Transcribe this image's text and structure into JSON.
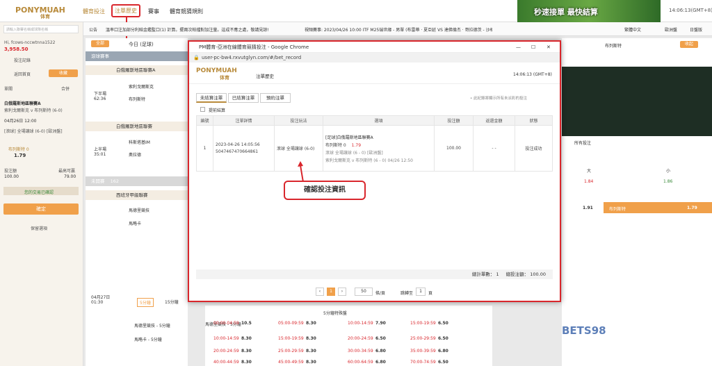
{
  "app": {
    "logo": "PONYMUAH",
    "logo_sub": "体育",
    "nav": [
      "體育投注",
      "注單歷史",
      "賽事",
      "體育競猜規則"
    ],
    "banner_text": "秒速接單 最快結算",
    "clock": "14:06:13(GMT+8)"
  },
  "announcement": {
    "label": "公告",
    "text": "溫率口注加部分利賠金鑑監口(1) 計算。擺兩次帕擋對加注量。這成不應之處，敬請見諒!",
    "event_text": "視頻賽事: 2023/04/26 10:00 ITF M25瑞世緣 - 男單 (布雷蒂 · 夏亞延 VS 達佛倫杰 · 哥拉德茨 - 沙格)",
    "lang": "繁體中文",
    "odds_type": "歐洲盤",
    "view": "日盤版"
  },
  "left": {
    "search_placeholder": "請輸入聯賽名稱或球隊名稱",
    "user": "Hi, fcows-nccwtnna1522",
    "balance": "3,958.50",
    "bet_records": "投注記錄",
    "back_home": "返回首頁",
    "view": "收藏",
    "single": "單關",
    "combo": "合併",
    "league": "白俄羅斯地區聯賽A",
    "match": "索利戈爾斯克 v 布列斯特 (6-0)",
    "date": "04月26日 12:00",
    "market": "[滾球] 全場讓球 (6-0) [歐洲盤]",
    "pick": "布列斯特 0",
    "odds": "1.79",
    "stake_label": "投注額",
    "max_label": "最高可贏",
    "stake": "100.00",
    "max_win": "79.00",
    "quick_bet": "您的交易已確認",
    "confirm": "確定",
    "keep": "保留選項"
  },
  "mid": {
    "filter_all": "全部",
    "today": "今日 (足球)",
    "live_label": "滾球賽事",
    "league1": "白俄羅斯地區聯賽A",
    "m1_time": "下半場\n62:36",
    "m1_home": "索利戈爾斯克",
    "m1_away": "布列斯特",
    "league2": "白俄羅斯地區聯賽",
    "m2_time": "上半場\n35:01",
    "m2_home": "科斯塔基IM",
    "m2_away": "奧拉德",
    "upcoming_label": "未開賽",
    "upcoming_count": "162",
    "league3": "西班牙甲級聯賽",
    "m3_home": "馬德里競技",
    "m3_away": "馬略卡",
    "m4_date": "04月27日\n01:30",
    "m4_tag": "5分鐘",
    "m4_tag2": "15分鐘"
  },
  "dialog": {
    "window_title": "PM體育-亞洲在線體育競猜投注 - Google Chrome",
    "url": "user-pc-bw4.rxvutglyn.com/#/bet_record",
    "logo": "PONYMUAH",
    "logo_sub": "体育",
    "section_title": "注單歷史",
    "time": "14:06:13 (GMT+8)",
    "tabs": [
      "未結算注單",
      "已結算注單",
      "預約注單"
    ],
    "note": "• 此紀錄將顯示所有未派彩的投注",
    "checkbox_label": "提前結算",
    "headers": [
      "編號",
      "注單詳情",
      "投注玩法",
      "選項",
      "投注額",
      "返還金額",
      "狀態"
    ],
    "row": {
      "no": "1",
      "datetime": "2023-04-26 14:05:56",
      "bet_id": "5047467470664861",
      "play": "滾球 全場讓球 (6-0)",
      "league": "[足球]白俄羅斯地區聯賽A",
      "pick_line": "布列斯特 0",
      "pick_odds": "1.79",
      "market": "滾球 全場讓球 (6 - 0) [歐洲盤]",
      "match": "索利戈爾斯克 v 布列斯特 (6 - 0) 04/26 12:50",
      "stake": "100.00",
      "return": "- -",
      "status": "投注成功"
    },
    "summary_count_label": "總計單數：",
    "summary_count": "1",
    "summary_stake_label": "總投注額：",
    "summary_stake": "100.00",
    "page_size": "50",
    "page_size_suffix": "條/頁",
    "current_page": "1",
    "goto_label": "跳轉至",
    "goto_page": "1",
    "goto_suffix": "頁"
  },
  "callout": "確認投注資訊",
  "right": {
    "live_tag": "布列斯特",
    "fav": "收起",
    "all_bets": "所有投注",
    "big": "大",
    "small": "小",
    "odds_big": "1.84",
    "odds_small": "1.86",
    "odds_row1": "1.91",
    "pick_away": "布列斯特",
    "odds_row2": "1.79"
  },
  "odds_table": {
    "title": "5分鐘特殊盤",
    "rows": [
      {
        "team": "馬德里競技 - 5分鐘",
        "c1": "00:00-04:59",
        "o1": "10.5",
        "c2": "05:00-09:59",
        "o2": "8.30",
        "c3": "10:00-14:59",
        "o3": "7.90",
        "c4": "15:00-19:59",
        "o4": "6.50"
      },
      {
        "team": "馬略卡 - 5分鐘",
        "c1": "10:00-14:59",
        "o1": "8.30",
        "c2": "15:00-19:59",
        "o2": "8.30",
        "c3": "20:00-24:59",
        "o3": "6.50",
        "c4": "25:00-29:59",
        "o4": "6.50"
      },
      {
        "team": "",
        "c1": "20:00-24:59",
        "o1": "8.30",
        "c2": "25:00-29:59",
        "o2": "8.30",
        "c3": "30:00-34:59",
        "o3": "6.80",
        "c4": "35:00-39:59",
        "o4": "6.80"
      },
      {
        "team": "",
        "c1": "40:00-44:59",
        "o1": "8.30",
        "c2": "45:00-49:59",
        "o2": "8.30",
        "c3": "60:00-64:59",
        "o3": "6.80",
        "c4": "70:00-74:59",
        "o4": "6.50"
      }
    ]
  },
  "watermark": "BETS98"
}
